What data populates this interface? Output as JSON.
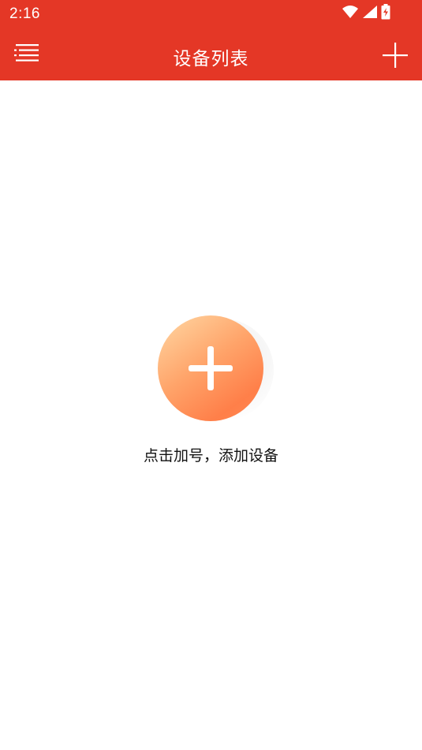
{
  "status_bar": {
    "time": "2:16",
    "icons": [
      "wifi-icon",
      "signal-icon",
      "battery-charging-icon"
    ]
  },
  "toolbar": {
    "title": "设备列表",
    "menu_icon": "menu-icon",
    "add_icon": "plus-icon",
    "background_color": "#e43726"
  },
  "empty_state": {
    "add_icon": "plus-icon",
    "hint": "点击加号，添加设备"
  }
}
